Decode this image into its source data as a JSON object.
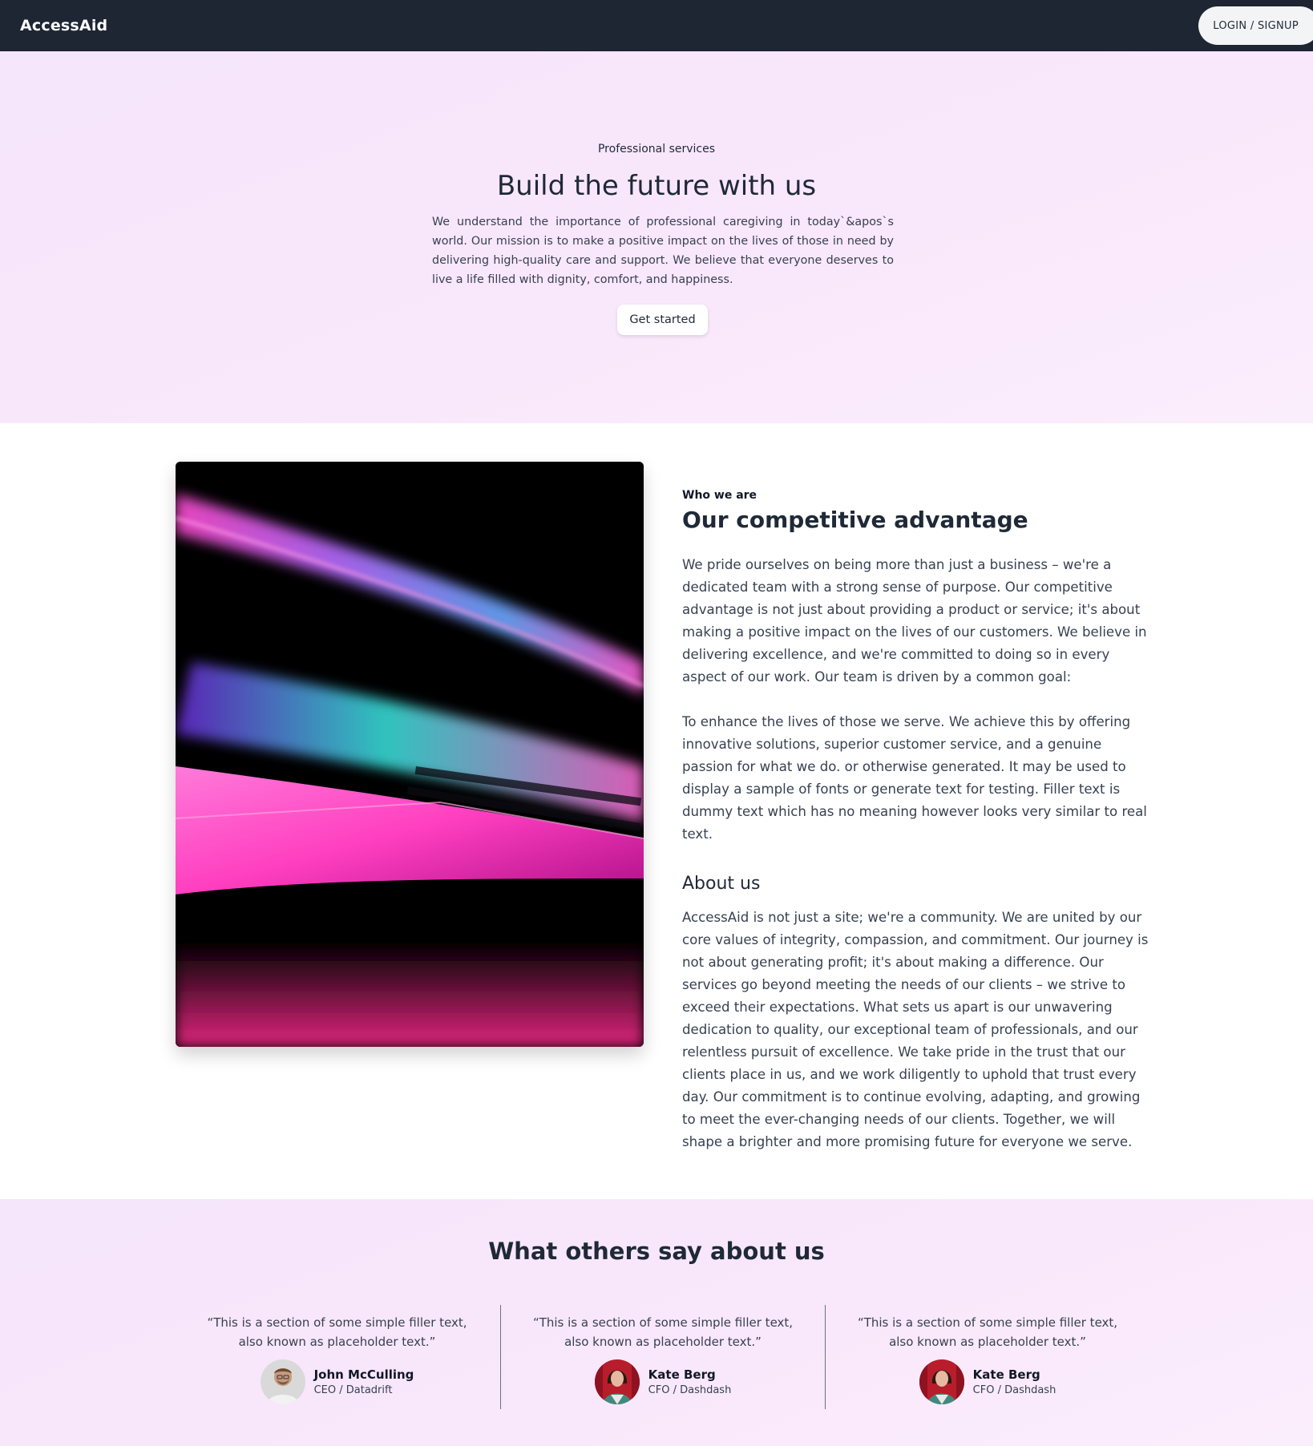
{
  "nav": {
    "brand": "AccessAid",
    "login_label": "LOGIN / SIGNUP"
  },
  "hero": {
    "kicker": "Professional services",
    "title": "Build the future with us",
    "description": "We understand the importance of professional caregiving in today`&apos`s world. Our mission is to make a positive impact on the lives of those in need by delivering high-quality care and support. We believe that everyone deserves to live a life filled with dignity, comfort, and happiness.",
    "cta_label": "Get started"
  },
  "about": {
    "kicker": "Who we are",
    "title": "Our competitive advantage",
    "paragraph_1": "We pride ourselves on being more than just a business – we're a dedicated team with a strong sense of purpose. Our competitive advantage is not just about providing a product or service; it's about making a positive impact on the lives of our customers. We believe in delivering excellence, and we're committed to doing so in every aspect of our work. Our team is driven by a common goal:",
    "paragraph_2": "To enhance the lives of those we serve. We achieve this by offering innovative solutions, superior customer service, and a genuine passion for what we do. or otherwise generated. It may be used to display a sample of fonts or generate text for testing. Filler text is dummy text which has no meaning however looks very similar to real text.",
    "subtitle": "About us",
    "paragraph_3": "AccessAid is not just a site; we're a community. We are united by our core values of integrity, compassion, and commitment. Our journey is not about generating profit; it's about making a difference. Our services go beyond meeting the needs of our clients – we strive to exceed their expectations. What sets us apart is our unwavering dedication to quality, our exceptional team of professionals, and our relentless pursuit of excellence. We take pride in the trust that our clients place in us, and we work diligently to uphold that trust every day. Our commitment is to continue evolving, adapting, and growing to meet the ever-changing needs of our clients. Together, we will shape a brighter and more promising future for everyone we serve."
  },
  "testimonials": {
    "title": "What others say about us",
    "items": [
      {
        "quote": "“This is a section of some simple filler text, also known as placeholder text.”",
        "name": "John McCulling",
        "role": "CEO / Datadrift"
      },
      {
        "quote": "“This is a section of some simple filler text, also known as placeholder text.”",
        "name": "Kate Berg",
        "role": "CFO / Dashdash"
      },
      {
        "quote": "“This is a section of some simple filler text, also known as placeholder text.”",
        "name": "Kate Berg",
        "role": "CFO / Dashdash"
      }
    ]
  },
  "colors": {
    "navbar": "#1e2533",
    "hero_bg": "#f8e7fb",
    "text": "#1f2937"
  }
}
